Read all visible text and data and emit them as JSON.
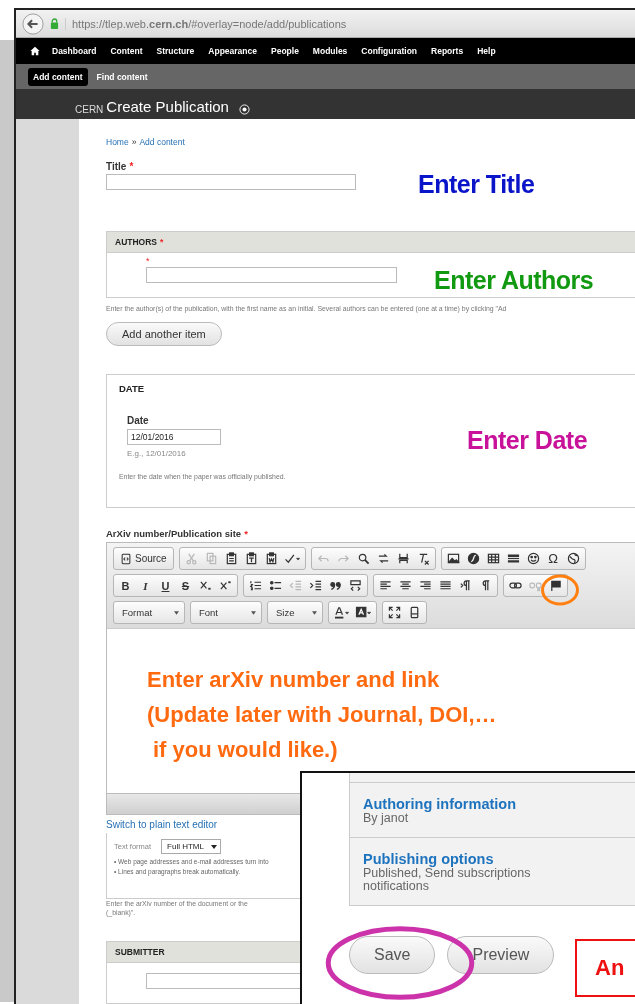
{
  "browser": {
    "url": "https://tlep.web.**cern.ch**/#overlay=node/add/publications"
  },
  "admin_menu": [
    "Dashboard",
    "Content",
    "Structure",
    "Appearance",
    "People",
    "Modules",
    "Configuration",
    "Reports",
    "Help"
  ],
  "shortcuts": [
    {
      "label": "Add content",
      "selected": true
    },
    {
      "label": "Find content",
      "selected": false
    }
  ],
  "overlay": {
    "site": "CERN",
    "title": "Create Publication"
  },
  "breadcrumb": {
    "items": [
      "Home",
      "Add content"
    ],
    "separator": "»"
  },
  "title_field": {
    "label": "Title",
    "required_mark": "*"
  },
  "authors": {
    "legend": "AUTHORS",
    "required_mark": "*",
    "item_mark": "*",
    "description": "Enter the author(s) of the publication, with the first name as an initial. Several authors can be entered (one at a time) by clicking \"Ad",
    "add_button": "Add another item"
  },
  "date": {
    "legend": "DATE",
    "label": "Date",
    "value": "12/01/2016",
    "hint": "E.g., 12/01/2016",
    "description": "Enter the date when the paper was officially published."
  },
  "arxiv": {
    "label": "ArXiv number/Publication site",
    "required_mark": "*",
    "toolbar": [
      [
        [
          {
            "kind": "labeled",
            "label": "Source",
            "disabled": false
          }
        ],
        [
          {
            "kind": "icon",
            "disabled": true
          },
          {
            "kind": "icon",
            "disabled": true
          },
          {
            "kind": "icon",
            "disabled": false
          },
          {
            "kind": "icon",
            "disabled": false
          },
          {
            "kind": "icon",
            "disabled": false
          },
          {
            "kind": "icon",
            "disabled": false
          }
        ],
        [
          {
            "kind": "icon",
            "disabled": true
          },
          {
            "kind": "icon",
            "disabled": true
          },
          {
            "kind": "icon",
            "disabled": false
          },
          {
            "kind": "icon",
            "disabled": false
          },
          {
            "kind": "icon",
            "disabled": false
          },
          {
            "kind": "icon",
            "disabled": false
          }
        ],
        [
          {
            "kind": "icon",
            "disabled": false
          },
          {
            "kind": "icon",
            "disabled": false
          },
          {
            "kind": "icon",
            "disabled": false
          },
          {
            "kind": "icon",
            "disabled": false
          },
          {
            "kind": "icon",
            "disabled": false
          },
          {
            "kind": "glyph",
            "label": "Ω",
            "disabled": false
          },
          {
            "kind": "icon",
            "disabled": false
          }
        ]
      ],
      [
        [
          {
            "kind": "bold",
            "label": "B",
            "disabled": false
          },
          {
            "kind": "italic",
            "label": "I",
            "disabled": false
          },
          {
            "kind": "underline",
            "label": "U",
            "disabled": false
          },
          {
            "kind": "strike",
            "label": "S",
            "disabled": false
          },
          {
            "kind": "icon",
            "disabled": false
          },
          {
            "kind": "icon",
            "disabled": false
          }
        ],
        [
          {
            "kind": "icon",
            "disabled": false
          },
          {
            "kind": "icon",
            "disabled": false
          },
          {
            "kind": "icon",
            "disabled": true
          },
          {
            "kind": "icon",
            "disabled": false
          },
          {
            "kind": "icon",
            "disabled": false
          },
          {
            "kind": "icon",
            "disabled": false
          }
        ],
        [
          {
            "kind": "icon",
            "disabled": false
          },
          {
            "kind": "icon",
            "disabled": false
          },
          {
            "kind": "icon",
            "disabled": false
          },
          {
            "kind": "icon",
            "disabled": false
          },
          {
            "kind": "icon",
            "disabled": false
          },
          {
            "kind": "icon",
            "disabled": false
          }
        ],
        [
          {
            "kind": "icon",
            "disabled": false
          },
          {
            "kind": "icon",
            "disabled": true
          },
          {
            "kind": "icon",
            "disabled": false
          }
        ]
      ],
      [
        [
          {
            "kind": "dropdown",
            "label": "Format"
          }
        ],
        [
          {
            "kind": "dropdown",
            "label": "Font"
          }
        ],
        [
          {
            "kind": "dropdown",
            "label": "Size"
          }
        ],
        [
          {
            "kind": "icon",
            "disabled": false
          },
          {
            "kind": "icon",
            "disabled": false
          }
        ],
        [
          {
            "kind": "icon",
            "disabled": false
          },
          {
            "kind": "icon",
            "disabled": false
          }
        ]
      ]
    ],
    "switch_link": "Switch to plain text editor",
    "text_format": {
      "label": "Text format",
      "value": "Full HTML"
    },
    "tips": [
      "• Web page addresses and e-mail addresses turn into",
      "• Lines and paragraphs break automatically."
    ],
    "description": [
      "Enter the arXiv number of the document or the",
      "(_blank)”."
    ]
  },
  "submitter": {
    "legend": "SUBMITTER"
  },
  "side_panel": {
    "tabs": [
      {
        "title": "Authoring information",
        "summary": "By janot"
      },
      {
        "title": "Publishing options",
        "summary": "Published, Send subscriptions notifications"
      }
    ],
    "buttons": [
      "Save",
      "Preview"
    ]
  },
  "annotations": [
    {
      "kind": "plain",
      "color": "#0a14c8",
      "lines": [
        "Enter Title"
      ]
    },
    {
      "kind": "plain",
      "color": "#119a11",
      "lines": [
        "Enter Authors"
      ]
    },
    {
      "kind": "plain",
      "color": "#c8129a",
      "lines": [
        "Enter Date"
      ]
    },
    {
      "kind": "plain",
      "color": "#ff6a10",
      "lines": [
        "Enter arXiv number and link",
        "(Update later with Journal, DOI,…",
        "if you would like.)"
      ]
    },
    {
      "kind": "boxed",
      "color": "#ee1111",
      "lines": [
        "An"
      ]
    }
  ],
  "highlights": [
    {
      "color": "#ff8010"
    },
    {
      "color": "#cc33aa"
    }
  ]
}
